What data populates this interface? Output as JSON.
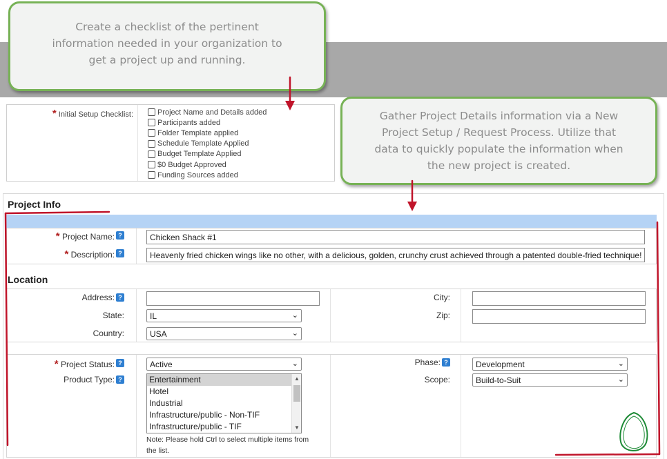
{
  "callouts": {
    "top": [
      "Create a checklist of the pertinent",
      "information needed in your organization to",
      "get a project up and running."
    ],
    "right": [
      "Gather Project Details information via a New",
      "Project Setup / Request Process.  Utilize that",
      "data to quickly populate the information when",
      "the new project is created."
    ]
  },
  "checklist": {
    "label": "Initial Setup Checklist:",
    "items": [
      "Project Name and Details added",
      "Participants added",
      "Folder Template applied",
      "Schedule Template Applied",
      "Budget Template Applied",
      "$0 Budget Approved",
      "Funding Sources added"
    ]
  },
  "project_info": {
    "title": "Project Info",
    "name_label": "Project Name:",
    "name_value": "Chicken Shack #1",
    "description_label": "Description:",
    "description_value": "Heavenly fried chicken wings like no other, with a delicious, golden, crunchy crust achieved through a patented double-fried technique!"
  },
  "location": {
    "title": "Location",
    "address_label": "Address:",
    "address_value": "",
    "state_label": "State:",
    "state_value": "IL",
    "country_label": "Country:",
    "country_value": "USA",
    "city_label": "City:",
    "city_value": "",
    "zip_label": "Zip:",
    "zip_value": ""
  },
  "details": {
    "status_label": "Project Status:",
    "status_value": "Active",
    "product_type_label": "Product Type:",
    "product_types": [
      "Entertainment",
      "Hotel",
      "Industrial",
      "Infrastructure/public - Non-TIF",
      "Infrastructure/public - TIF"
    ],
    "product_type_selected": "Entertainment",
    "note_line1": "Note: Please hold Ctrl to select multiple items from",
    "note_line2": "the list.",
    "phase_label": "Phase:",
    "phase_value": "Development",
    "scope_label": "Scope:",
    "scope_value": "Build-to-Suit"
  },
  "icons": {
    "help": "help-icon",
    "dropdown": "chevron-down-icon",
    "required": "required-asterisk"
  },
  "colors": {
    "callout_border": "#77b256",
    "annotation_red": "#c0142a",
    "section_bar": "#b5d3f5",
    "help_icon": "#2f7fd1"
  }
}
